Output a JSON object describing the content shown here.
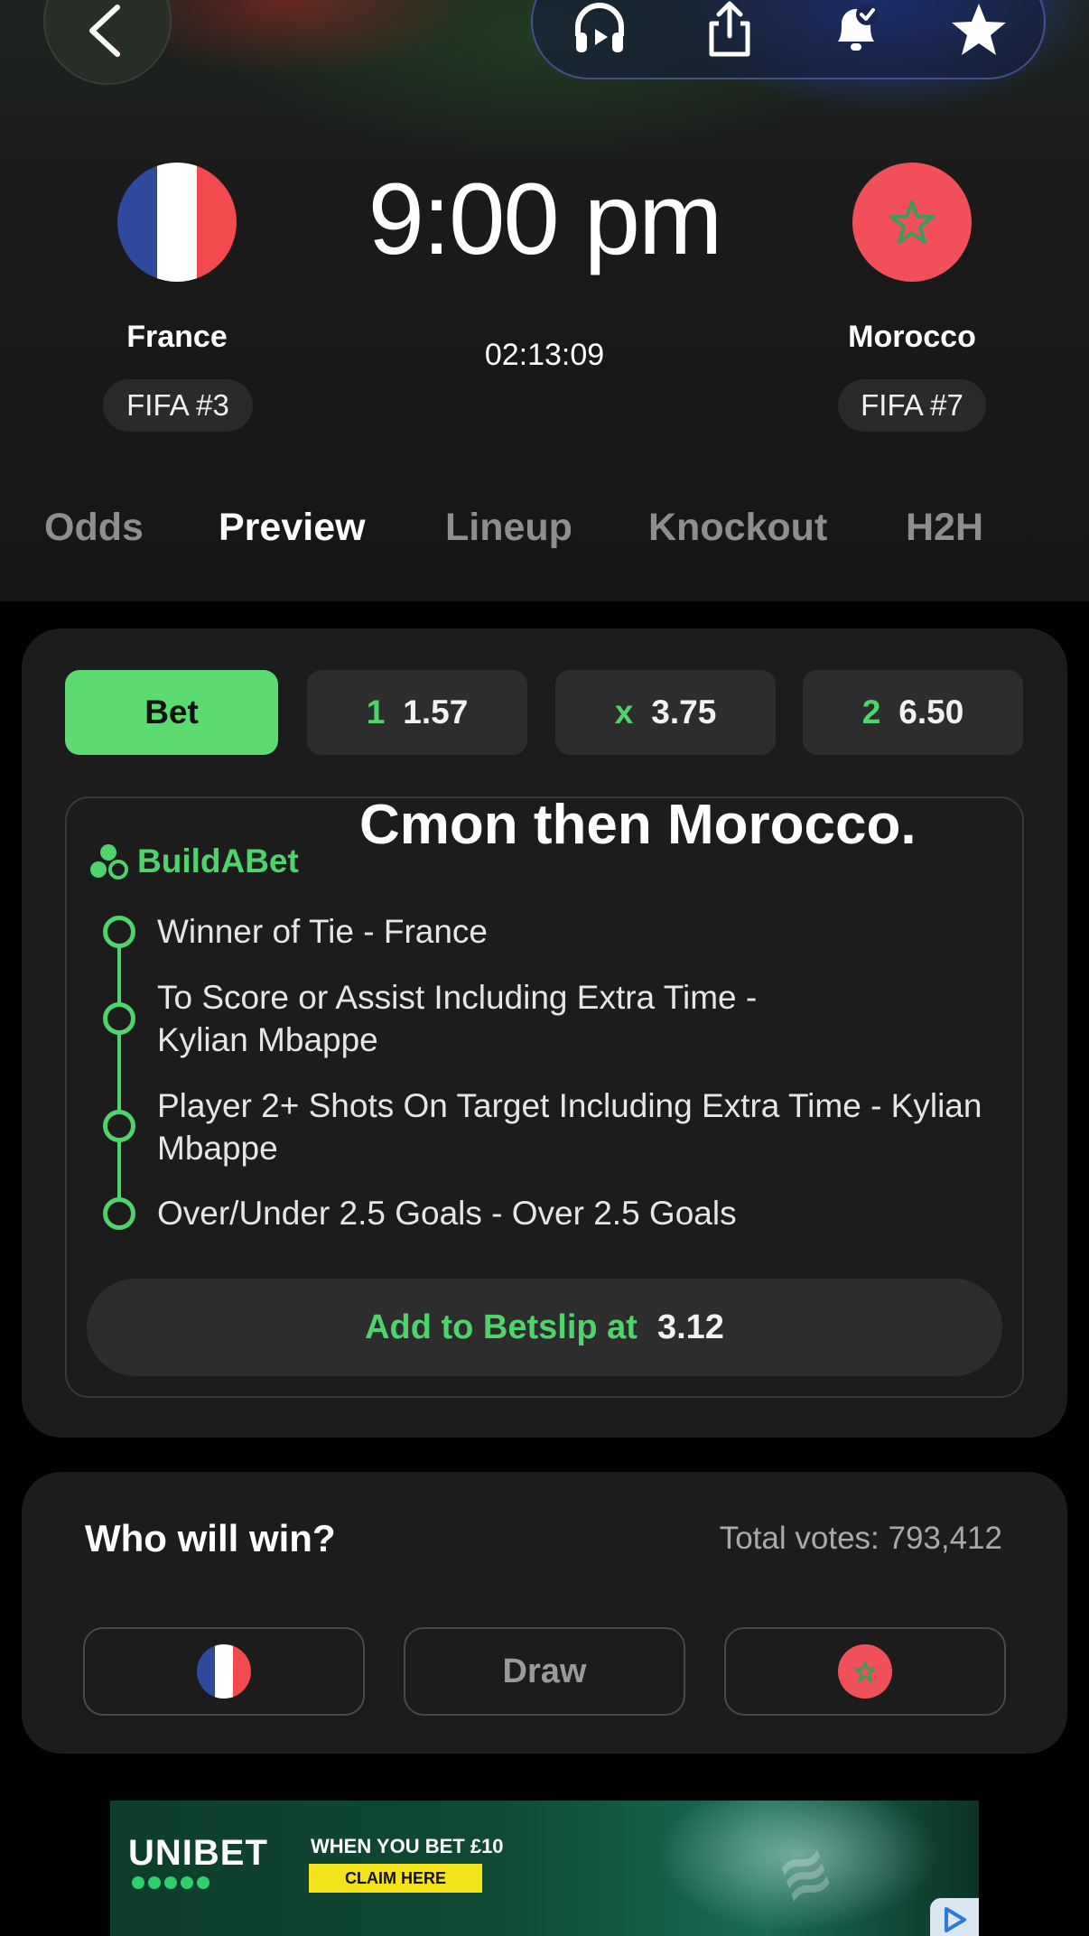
{
  "match": {
    "kickoff": "9:00 pm",
    "countdown": "02:13:09",
    "home": {
      "name": "France",
      "rank": "FIFA #3"
    },
    "away": {
      "name": "Morocco",
      "rank": "FIFA #7"
    }
  },
  "header_actions": [
    "back-icon",
    "headphones-icon",
    "share-icon",
    "bell-icon",
    "star-icon"
  ],
  "tabs": [
    {
      "label": "Odds",
      "active": false
    },
    {
      "label": "Preview",
      "active": true
    },
    {
      "label": "Lineup",
      "active": false
    },
    {
      "label": "Knockout",
      "active": false
    },
    {
      "label": "H2H",
      "active": false
    }
  ],
  "odds": {
    "bet_label": "Bet",
    "home": {
      "key": "1",
      "value": "1.57"
    },
    "draw": {
      "key": "x",
      "value": "3.75"
    },
    "away": {
      "key": "2",
      "value": "6.50"
    }
  },
  "buildabet": {
    "brand": "BuildABet",
    "caption": "Cmon then Morocco.",
    "legs": [
      "Winner of Tie - France",
      "To Score or Assist Including Extra Time - Kylian Mbappe",
      "Player 2+ Shots On Target Including Extra Time - Kylian Mbappe",
      "Over/Under 2.5 Goals - Over 2.5 Goals"
    ],
    "add_label": "Add to Betslip at",
    "add_odds": "3.12"
  },
  "poll": {
    "title": "Who will win?",
    "total_votes": "Total votes: 793,412",
    "draw_label": "Draw"
  },
  "ad": {
    "brand": "UNIBET",
    "headline": "WHEN YOU BET £10",
    "cta": "CLAIM HERE"
  },
  "colors": {
    "accent_green": "#5cdb70",
    "france_blue": "#2e4a9e",
    "france_red": "#f24a4f",
    "morocco_red": "#f25059",
    "morocco_star": "#3c9a5a"
  }
}
